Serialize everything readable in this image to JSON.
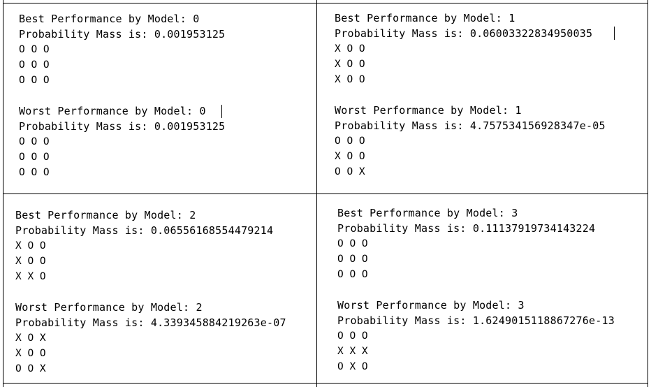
{
  "panels": [
    {
      "best": {
        "header": "Best Performance by Model: 0",
        "prob": "Probability Mass is: 0.001953125",
        "board": [
          "O O O",
          "O O O",
          "O O O"
        ]
      },
      "worst": {
        "header": "Worst Performance by Model: 0",
        "prob": "Probability Mass is: 0.001953125",
        "board": [
          "O O O",
          "O O O",
          "O O O"
        ]
      }
    },
    {
      "best": {
        "header": "Best Performance by Model: 1",
        "prob": "Probability Mass is: 0.06003322834950035",
        "board": [
          "X O O",
          "X O O",
          "X O O"
        ]
      },
      "worst": {
        "header": "Worst Performance by Model: 1",
        "prob": "Probability Mass is: 4.757534156928347e-05",
        "board": [
          "O O O",
          "X O O",
          "O O X"
        ]
      }
    },
    {
      "best": {
        "header": "Best Performance by Model: 2",
        "prob": "Probability Mass is: 0.06556168554479214",
        "board": [
          "X O O",
          "X O O",
          "X X O"
        ]
      },
      "worst": {
        "header": "Worst Performance by Model: 2",
        "prob": "Probability Mass is: 4.339345884219263e-07",
        "board": [
          "X O X",
          "X O O",
          "O O X"
        ]
      }
    },
    {
      "best": {
        "header": "Best Performance by Model: 3",
        "prob": "Probability Mass is: 0.11137919734143224",
        "board": [
          "O O O",
          "O O O",
          "O O O"
        ]
      },
      "worst": {
        "header": "Worst Performance by Model: 3",
        "prob": "Probability Mass is: 1.6249015118867276e-13",
        "board": [
          "O O O",
          "X X X",
          "O X O"
        ]
      }
    }
  ]
}
